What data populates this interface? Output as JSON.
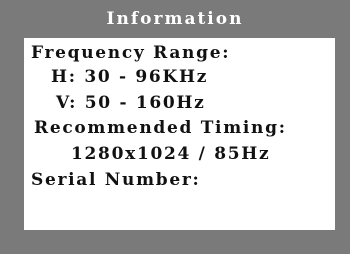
{
  "osd": {
    "title": "Information",
    "lines": [
      "Frequency Range:",
      "H: 30 - 96KHz",
      "V: 50 - 160Hz",
      "Recommended Timing:",
      "1280x1024 / 85Hz",
      "Serial Number:"
    ]
  },
  "colors": {
    "background": "#7a7a7a",
    "panel": "#ffffff",
    "title_text": "#ffffff",
    "panel_text": "#111111"
  }
}
